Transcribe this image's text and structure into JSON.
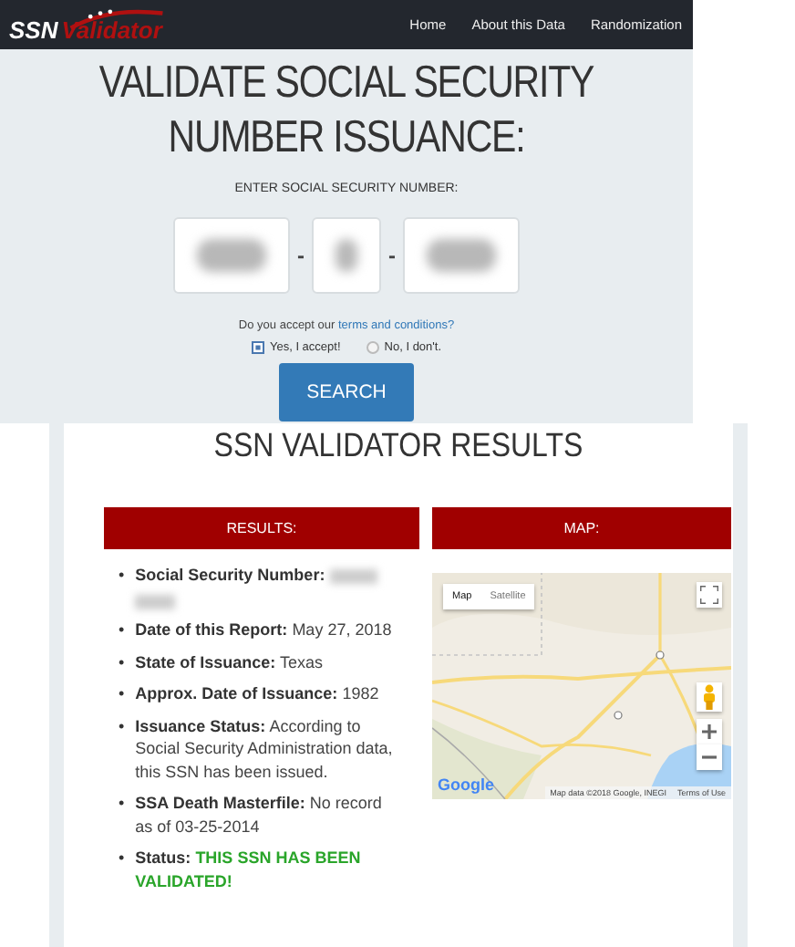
{
  "logo": {
    "first": "SSN",
    "second": "Validator"
  },
  "nav": [
    {
      "label": "Home"
    },
    {
      "label": "About this Data"
    },
    {
      "label": "Randomization"
    }
  ],
  "hero": {
    "title_lines": [
      "VALIDATE SOCIAL SECURITY",
      "NUMBER ISSUANCE:"
    ],
    "prompt": "ENTER SOCIAL SECURITY NUMBER:",
    "separators": [
      "-",
      "-"
    ],
    "terms_before": "Do you accept our",
    "terms_link": "terms and conditions?",
    "radios": [
      {
        "label": "Yes, I accept!",
        "selected": true
      },
      {
        "label": "No, I don't.",
        "selected": false
      }
    ],
    "button": "SEARCH"
  },
  "results": {
    "title": "SSN VALIDATOR RESULTS",
    "panel_title": "RESULTS:",
    "bullet": "•",
    "items": [
      {
        "kind": "redacted",
        "label": "Social Security Number:"
      },
      {
        "kind": "plain",
        "label": "Date of this Report:",
        "value": "May 27, 2018"
      },
      {
        "kind": "plain",
        "label": "State of Issuance:",
        "value": "Texas"
      },
      {
        "kind": "plain",
        "label": "Approx. Date of Issuance:",
        "value": "1982"
      },
      {
        "kind": "plain",
        "label": "Issuance Status:",
        "value": "According to Social Security Administration data, this SSN has been issued."
      },
      {
        "kind": "plain",
        "label": "SSA Death Masterfile:",
        "value": "No record as of 03-25-2014"
      },
      {
        "kind": "success",
        "label": "Status:",
        "value": "THIS SSN HAS BEEN VALIDATED!"
      }
    ]
  },
  "map": {
    "panel_title": "MAP:",
    "tabs": [
      {
        "label": "Map",
        "selected": true
      },
      {
        "label": "Satellite",
        "selected": false
      }
    ],
    "brand": "Google",
    "attribution": "Map data ©2018 Google, INEGI",
    "terms": "Terms of Use"
  }
}
